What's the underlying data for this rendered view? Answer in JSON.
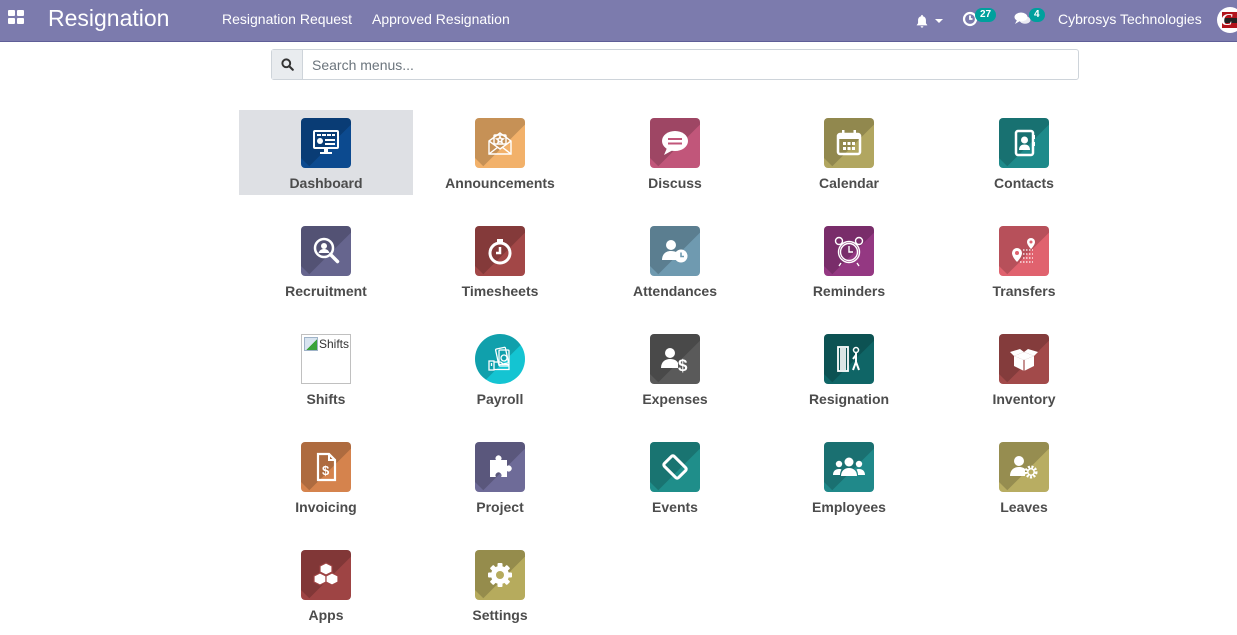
{
  "navbar": {
    "apps_icon": "grid-icon",
    "brand": "Resignation",
    "menu": [
      {
        "label": "Resignation Request"
      },
      {
        "label": "Approved Resignation"
      }
    ],
    "notifications_icon": "bell-icon",
    "activity_icon": "clock-icon",
    "activity_count": "27",
    "messages_icon": "comments-icon",
    "messages_count": "4",
    "company": "Cybrosys Technologies",
    "avatar_letter": "C"
  },
  "search": {
    "icon": "search-icon",
    "placeholder": "Search menus..."
  },
  "apps": [
    {
      "label": "Dashboard",
      "icon": "monitor-dashboard-icon",
      "color": "#0c4a8f",
      "active": true
    },
    {
      "label": "Announcements",
      "icon": "envelope-star-icon",
      "color": "#f2b16a"
    },
    {
      "label": "Discuss",
      "icon": "chat-bubble-icon",
      "color": "#c1567a"
    },
    {
      "label": "Calendar",
      "icon": "calendar-icon",
      "color": "#b1a660"
    },
    {
      "label": "Contacts",
      "icon": "address-book-icon",
      "color": "#1e8a8a"
    },
    {
      "label": "Recruitment",
      "icon": "magnifier-person-icon",
      "color": "#66658e"
    },
    {
      "label": "Timesheets",
      "icon": "stopwatch-icon",
      "color": "#a24747"
    },
    {
      "label": "Attendances",
      "icon": "user-clock-icon",
      "color": "#6f9ab0"
    },
    {
      "label": "Reminders",
      "icon": "alarm-clock-icon",
      "color": "#943882"
    },
    {
      "label": "Transfers",
      "icon": "map-pin-route-icon",
      "color": "#e0626e"
    },
    {
      "label": "Shifts",
      "icon": "broken-image-icon",
      "color": "#ffffff",
      "alt": "Shifts"
    },
    {
      "label": "Payroll",
      "icon": "hand-money-icon",
      "color": "#14c4d2"
    },
    {
      "label": "Expenses",
      "icon": "user-dollar-icon",
      "color": "#5a5a5a"
    },
    {
      "label": "Resignation",
      "icon": "person-door-icon",
      "color": "#0f6566"
    },
    {
      "label": "Inventory",
      "icon": "open-box-icon",
      "color": "#a24a4a"
    },
    {
      "label": "Invoicing",
      "icon": "invoice-dollar-icon",
      "color": "#d5834d"
    },
    {
      "label": "Project",
      "icon": "puzzle-icon",
      "color": "#6e6b98"
    },
    {
      "label": "Events",
      "icon": "ticket-icon",
      "color": "#1f8e8a"
    },
    {
      "label": "Employees",
      "icon": "users-group-icon",
      "color": "#20898a"
    },
    {
      "label": "Leaves",
      "icon": "user-gear-icon",
      "color": "#b8ad62"
    },
    {
      "label": "Apps",
      "icon": "cubes-icon",
      "color": "#9e4444"
    },
    {
      "label": "Settings",
      "icon": "gear-icon",
      "color": "#b6ab5d"
    }
  ]
}
